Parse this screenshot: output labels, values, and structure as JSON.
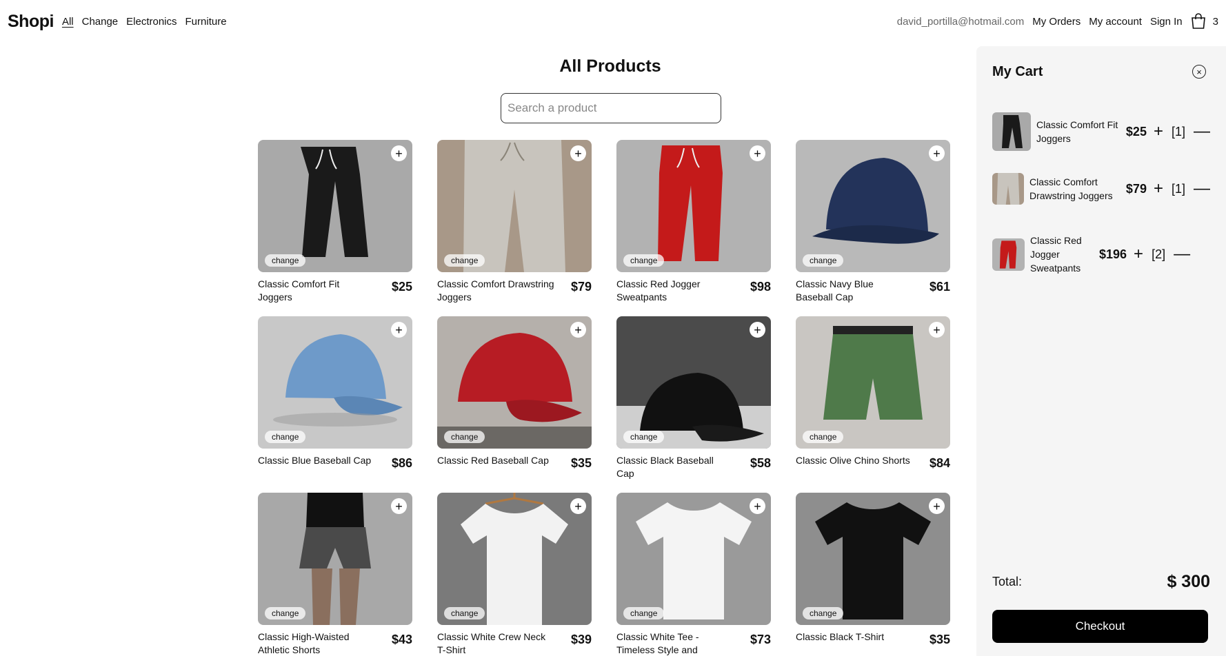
{
  "nav": {
    "brand": "Shopi",
    "categories": [
      {
        "label": "All",
        "active": true
      },
      {
        "label": "Change",
        "active": false
      },
      {
        "label": "Electronics",
        "active": false
      },
      {
        "label": "Furniture",
        "active": false
      }
    ],
    "email": "david_portilla@hotmail.com",
    "my_orders": "My Orders",
    "my_account": "My account",
    "sign_in": "Sign In",
    "cart_count": "3"
  },
  "main": {
    "title": "All Products",
    "search_placeholder": "Search a product",
    "add_symbol": "+",
    "products": [
      {
        "name": "Classic Comfort Fit Joggers",
        "price": "$25",
        "category": "change",
        "icon": "black-joggers"
      },
      {
        "name": "Classic Comfort Drawstring Joggers",
        "price": "$79",
        "category": "change",
        "icon": "beige-joggers"
      },
      {
        "name": "Classic Red Jogger Sweatpants",
        "price": "$98",
        "category": "change",
        "icon": "red-joggers"
      },
      {
        "name": "Classic Navy Blue Baseball Cap",
        "price": "$61",
        "category": "change",
        "icon": "navy-cap"
      },
      {
        "name": "Classic Blue Baseball Cap",
        "price": "$86",
        "category": "change",
        "icon": "blue-cap"
      },
      {
        "name": "Classic Red Baseball Cap",
        "price": "$35",
        "category": "change",
        "icon": "red-cap"
      },
      {
        "name": "Classic Black Baseball Cap",
        "price": "$58",
        "category": "change",
        "icon": "black-cap"
      },
      {
        "name": "Classic Olive Chino Shorts",
        "price": "$84",
        "category": "change",
        "icon": "olive-shorts"
      },
      {
        "name": "Classic High-Waisted Athletic Shorts",
        "price": "$43",
        "category": "change",
        "icon": "athletic-shorts"
      },
      {
        "name": "Classic White Crew Neck T-Shirt",
        "price": "$39",
        "category": "change",
        "icon": "white-tshirt-hanger"
      },
      {
        "name": "Classic White Tee - Timeless Style and Comfort",
        "price": "$73",
        "category": "change",
        "icon": "white-tshirt"
      },
      {
        "name": "Classic Black T-Shirt",
        "price": "$35",
        "category": "change",
        "icon": "black-tshirt"
      }
    ]
  },
  "cart": {
    "title": "My Cart",
    "close_symbol": "×",
    "items": [
      {
        "name": "Classic Comfort Fit Joggers",
        "price": "$25",
        "qty": "[1]",
        "icon": "black-joggers"
      },
      {
        "name": "Classic Comfort Drawstring Joggers",
        "price": "$79",
        "qty": "[1]",
        "icon": "beige-joggers"
      },
      {
        "name": "Classic Red Jogger Sweatpants",
        "price": "$196",
        "qty": "[2]",
        "icon": "red-joggers"
      }
    ],
    "plus_symbol": "+",
    "minus_symbol": "—",
    "total_label": "Total:",
    "total_value": "$ 300",
    "checkout_label": "Checkout"
  }
}
